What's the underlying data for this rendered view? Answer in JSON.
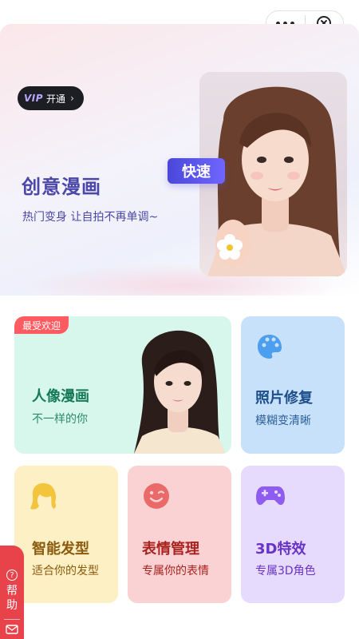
{
  "hero": {
    "vip_label": "开通",
    "title": "创意漫画",
    "subtitle": "热门变身 让自拍不再单调~",
    "tag": "快速"
  },
  "cards": {
    "portrait": {
      "badge": "最受欢迎",
      "title": "人像漫画",
      "subtitle": "不一样的你",
      "color": "#d7f7ec"
    },
    "photo": {
      "title": "照片修复",
      "subtitle": "模糊变清晰",
      "color": "#c8e1fb"
    },
    "hair": {
      "title": "智能发型",
      "subtitle": "适合你的发型",
      "color": "#fdf0c4"
    },
    "expression": {
      "title": "表情管理",
      "subtitle": "专属你的表情",
      "color": "#fbd2d3"
    },
    "three_d": {
      "title": "3D特效",
      "subtitle": "专属3D角色",
      "color": "#e6dbfd"
    }
  },
  "help": {
    "label": "帮助"
  },
  "icons": [
    "more-icon",
    "close-icon",
    "palette-icon",
    "hair-icon",
    "smile-icon",
    "gamepad-icon",
    "mail-icon",
    "question-icon"
  ]
}
